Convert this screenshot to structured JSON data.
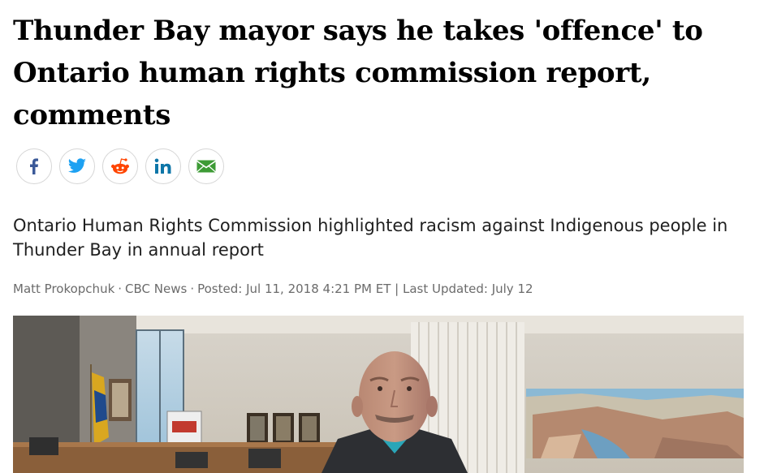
{
  "article": {
    "headline": "Thunder Bay mayor says he takes 'offence' to Ontario human rights commission report, comments",
    "deck": "Ontario Human Rights Commission highlighted racism against Indigenous people in Thunder Bay in annual report",
    "byline": {
      "author": "Matt Prokopchuk",
      "outlet": "CBC News",
      "posted_label": "Posted:",
      "posted": "Jul 11, 2018 4:21 PM ET",
      "separator": "|",
      "updated_label": "Last Updated:",
      "updated": "July 12"
    }
  },
  "share": {
    "buttons": [
      {
        "name": "facebook",
        "icon": "facebook-icon",
        "color": "#3b5998"
      },
      {
        "name": "twitter",
        "icon": "twitter-icon",
        "color": "#1da1f2"
      },
      {
        "name": "reddit",
        "icon": "reddit-icon",
        "color": "#ff4500"
      },
      {
        "name": "linkedin",
        "icon": "linkedin-icon",
        "color": "#0e76a8"
      },
      {
        "name": "email",
        "icon": "email-icon",
        "color": "#3d9b35"
      }
    ]
  },
  "photo": {
    "subject": "man in council chamber"
  }
}
